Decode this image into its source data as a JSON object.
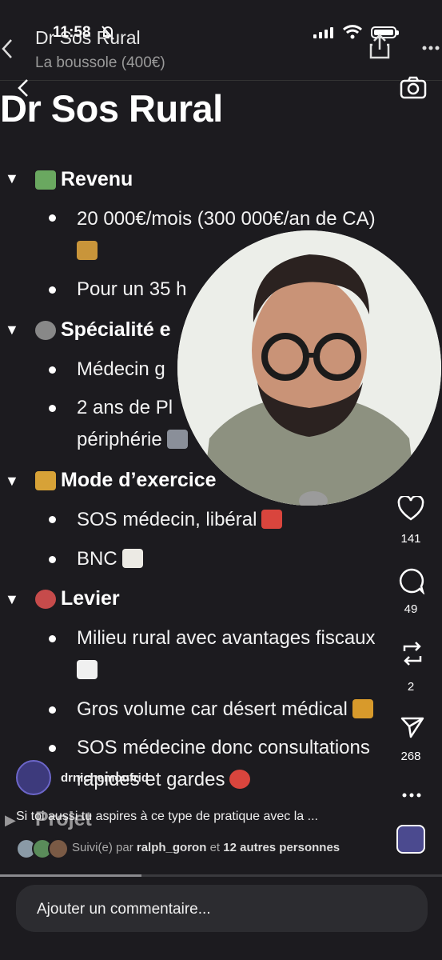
{
  "status": {
    "time": "11:58"
  },
  "header": {
    "title": "Dr Sos Rural",
    "subtitle": "La boussole (400€)"
  },
  "doc": {
    "title": "Dr Sos Rural",
    "sections": [
      {
        "label": "Revenu",
        "icon": "money-emoji",
        "items": [
          "20 000€/mois (300 000€/an de CA)",
          "Pour un 35 h"
        ]
      },
      {
        "label": "Spécialité e",
        "icon": "stethoscope-emoji",
        "items": [
          "Médecin g",
          "2 ans de Pl",
          "périphérie"
        ]
      },
      {
        "label": "Mode d’exercice",
        "icon": "crane-emoji",
        "items": [
          "SOS médecin, libéral",
          "BNC"
        ]
      },
      {
        "label": "Levier",
        "icon": "rocket-emoji",
        "items": [
          "Milieu rural avec avantages fiscaux",
          "Gros volume car désert médical",
          "SOS médecine donc consultations",
          "rapides et gardes"
        ]
      },
      {
        "label": "Projet",
        "icon": "project-emoji",
        "items": []
      }
    ]
  },
  "rail": {
    "likes": "141",
    "comments": "49",
    "reposts": "2",
    "shares": "268"
  },
  "post": {
    "username": "drnichemoufrid",
    "caption": "Si toi aussi tu aspires à ce type de pratique avec la ...",
    "followed_prefix": "Suivi(e) par",
    "followed_user": "ralph_goron",
    "followed_and": "et",
    "followed_others": "12 autres personnes",
    "progress": 0.32
  },
  "comment": {
    "placeholder": "Ajouter un commentaire..."
  },
  "colors": {
    "background": "#1c1b1f",
    "text": "#ffffff",
    "muted": "#9a9a9a",
    "input": "#2c2c30"
  }
}
